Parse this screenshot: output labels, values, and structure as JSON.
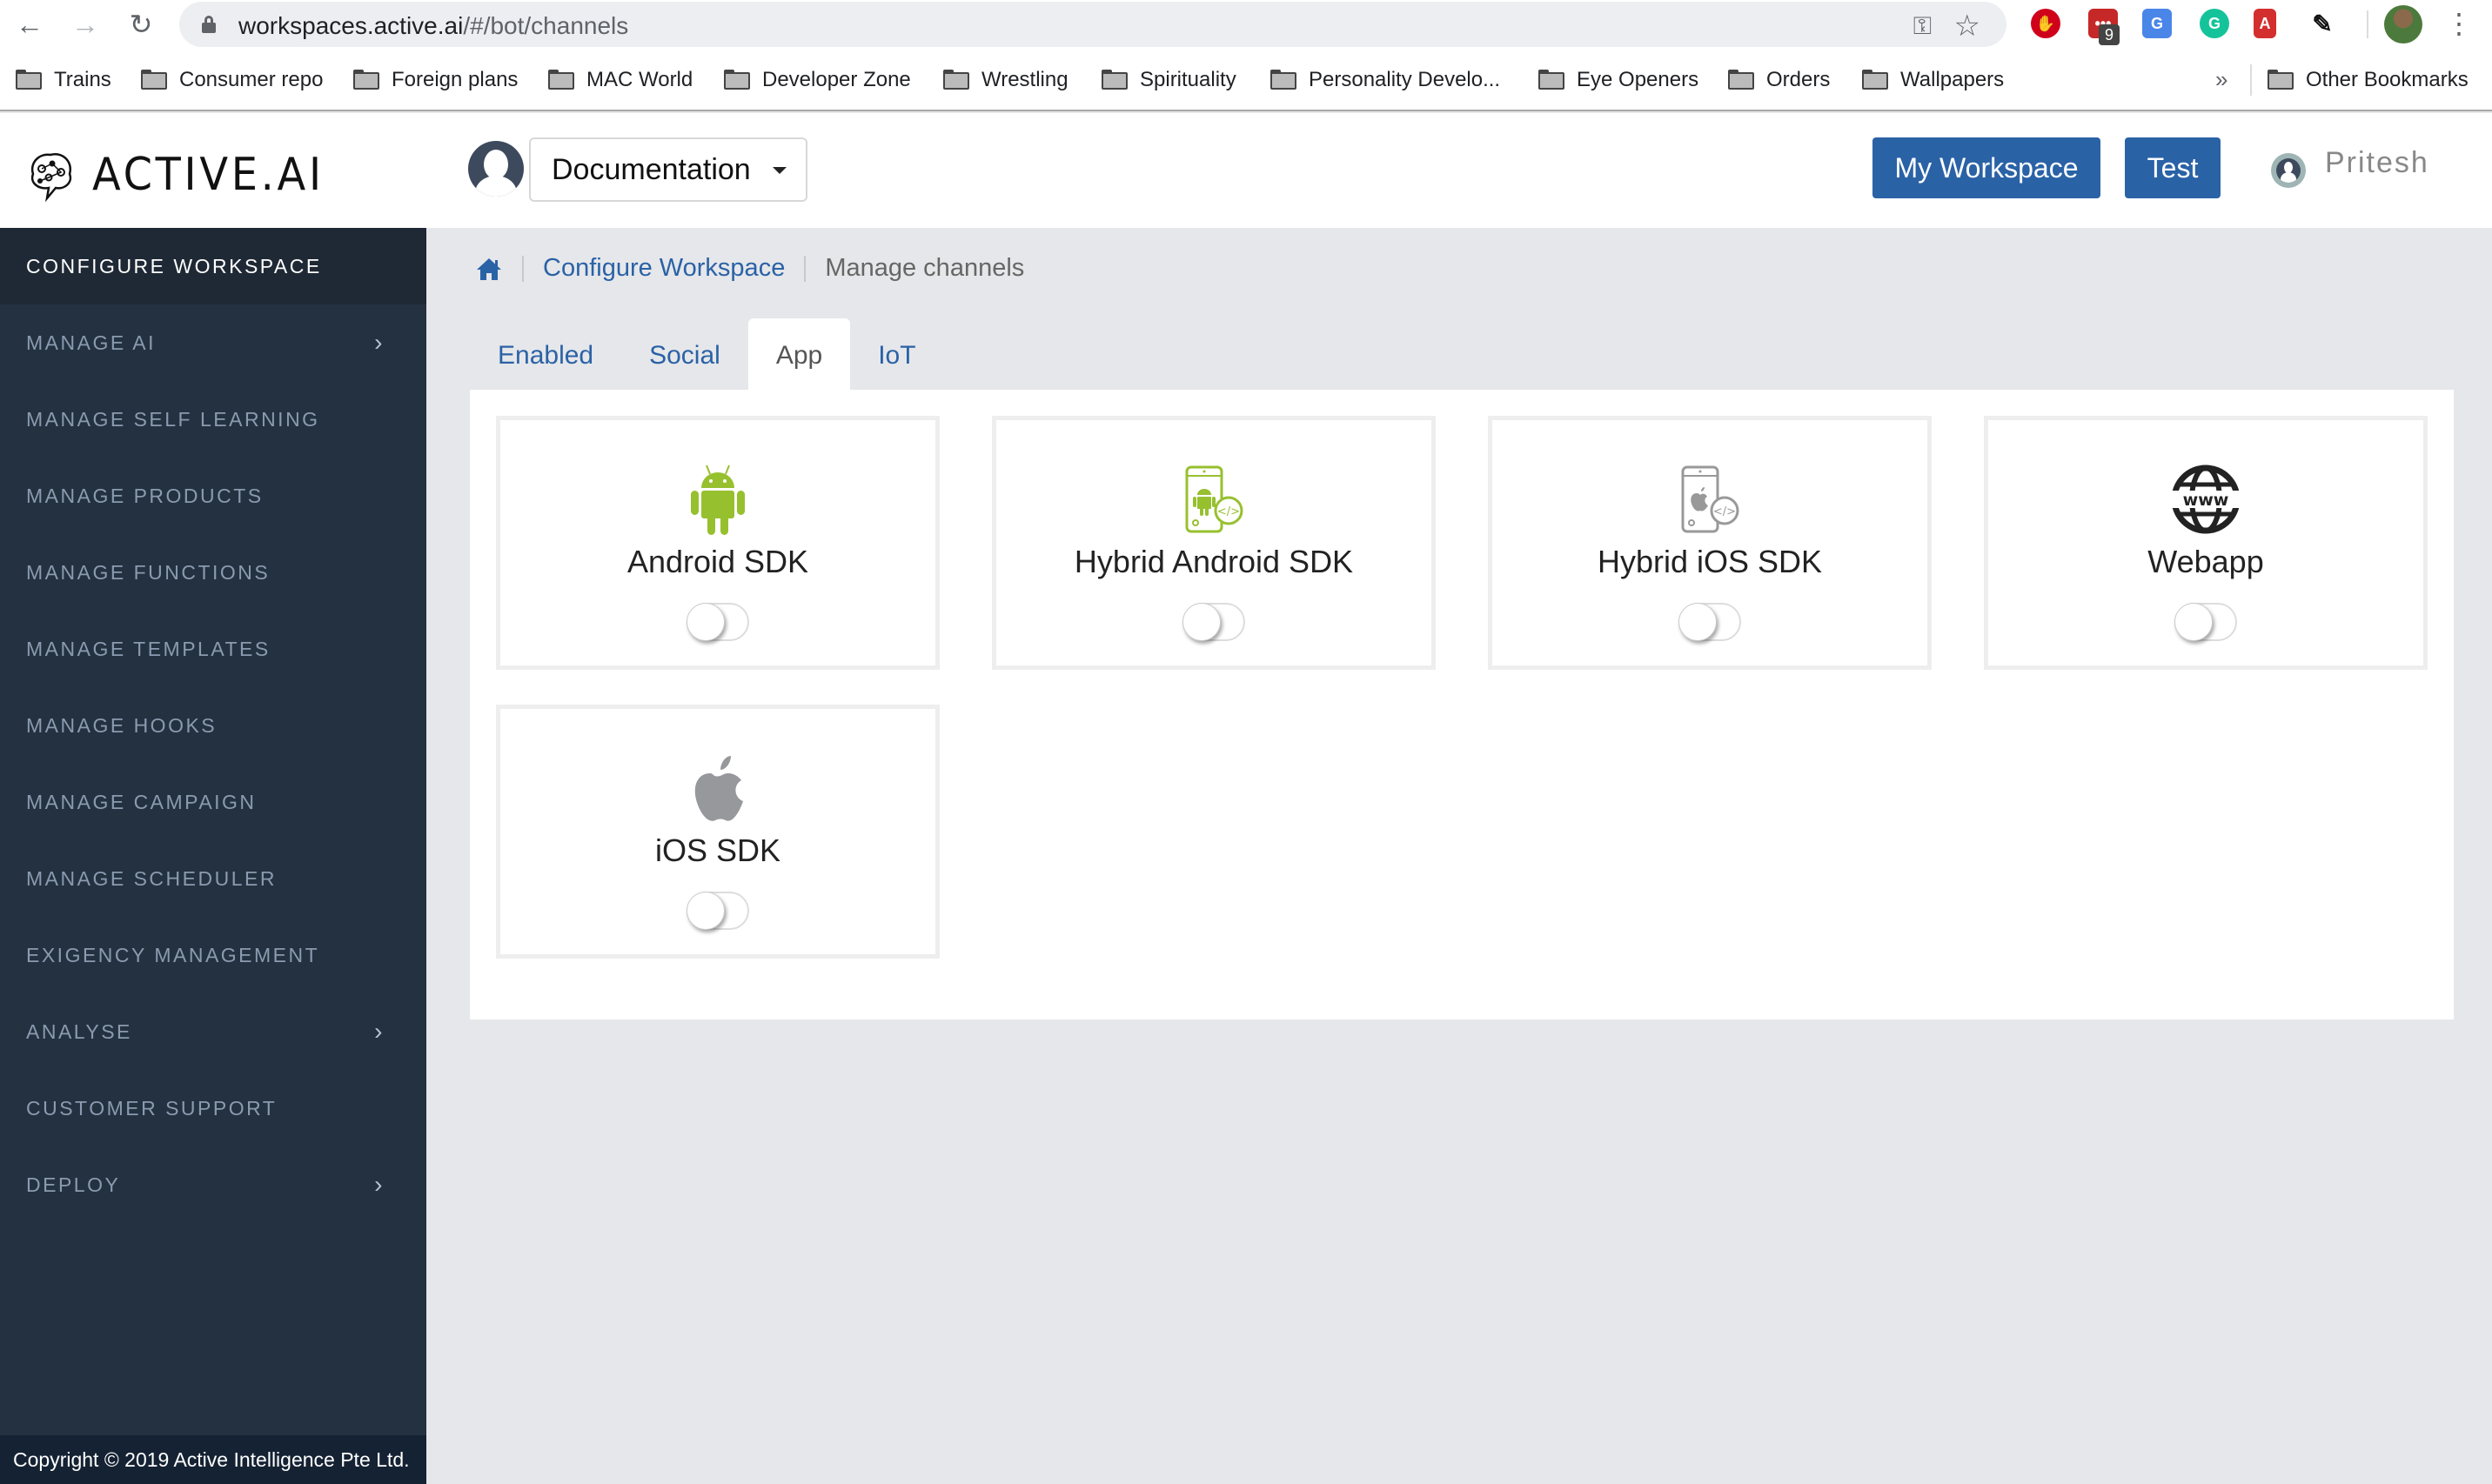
{
  "browser": {
    "url_host": "workspaces.active.ai",
    "url_path": "/#/bot/channels",
    "extensions_badge": "9",
    "bookmarks": [
      "Trains",
      "Consumer repo",
      "Foreign plans",
      "MAC World",
      "Developer Zone",
      "Wrestling",
      "Spirituality",
      "Personality Develo...",
      "Eye Openers",
      "Orders",
      "Wallpapers"
    ],
    "bookmarks_overflow": "»",
    "other_bookmarks": "Other Bookmarks"
  },
  "header": {
    "logo_text": "ACTIVE.AI",
    "workspace_selected": "Documentation",
    "my_workspace_label": "My Workspace",
    "test_label": "Test",
    "user_name": "Pritesh"
  },
  "sidebar": {
    "title": "CONFIGURE WORKSPACE",
    "items": [
      {
        "label": "MANAGE AI",
        "has_submenu": true
      },
      {
        "label": "MANAGE SELF LEARNING",
        "has_submenu": false
      },
      {
        "label": "MANAGE PRODUCTS",
        "has_submenu": false
      },
      {
        "label": "MANAGE FUNCTIONS",
        "has_submenu": false
      },
      {
        "label": "MANAGE TEMPLATES",
        "has_submenu": false
      },
      {
        "label": "MANAGE HOOKS",
        "has_submenu": false
      },
      {
        "label": "MANAGE CAMPAIGN",
        "has_submenu": false
      },
      {
        "label": "MANAGE SCHEDULER",
        "has_submenu": false
      },
      {
        "label": "EXIGENCY MANAGEMENT",
        "has_submenu": false
      },
      {
        "label": "ANALYSE",
        "has_submenu": true
      },
      {
        "label": "CUSTOMER SUPPORT",
        "has_submenu": false
      },
      {
        "label": "DEPLOY",
        "has_submenu": true
      }
    ],
    "chevron": "›",
    "footer": "Copyright © 2019 Active Intelligence Pte Ltd."
  },
  "breadcrumb": {
    "parent": "Configure Workspace",
    "current": "Manage channels"
  },
  "tabs": [
    {
      "label": "Enabled",
      "active": false
    },
    {
      "label": "Social",
      "active": false
    },
    {
      "label": "App",
      "active": true
    },
    {
      "label": "IoT",
      "active": false
    }
  ],
  "channels": [
    {
      "name": "Android SDK",
      "icon": "android-icon",
      "enabled": false
    },
    {
      "name": "Hybrid Android SDK",
      "icon": "hybrid-android-icon",
      "enabled": false
    },
    {
      "name": "Hybrid iOS SDK",
      "icon": "hybrid-ios-icon",
      "enabled": false
    },
    {
      "name": "Webapp",
      "icon": "www-globe-icon",
      "enabled": false
    },
    {
      "name": "iOS SDK",
      "icon": "apple-icon",
      "enabled": false
    }
  ],
  "colors": {
    "primary": "#2a62a6",
    "sidebar_bg": "#243140",
    "android_green": "#97c02f",
    "apple_gray": "#97989b"
  }
}
